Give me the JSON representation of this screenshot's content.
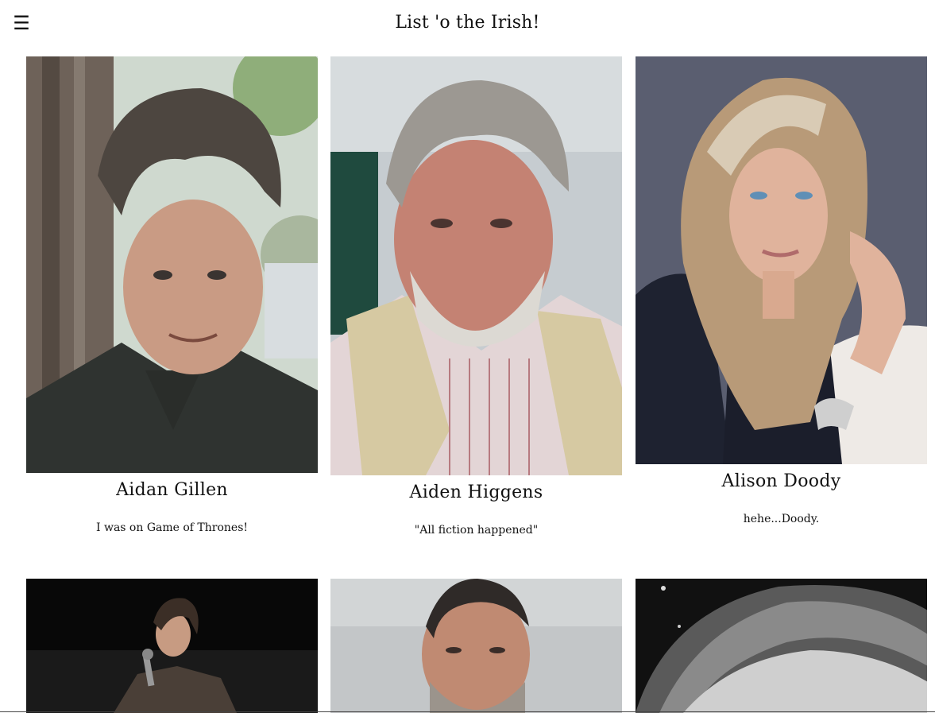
{
  "header": {
    "menu_icon": "hamburger-menu-icon",
    "menu_glyph": "☰",
    "title": "List 'o the Irish!"
  },
  "cards": [
    {
      "name": "Aidan Gillen",
      "quote": "I was on Game of Thrones!"
    },
    {
      "name": "Aiden Higgens",
      "quote": "\"All fiction happened\""
    },
    {
      "name": "Alison Doody",
      "quote": "hehe...Doody."
    }
  ]
}
